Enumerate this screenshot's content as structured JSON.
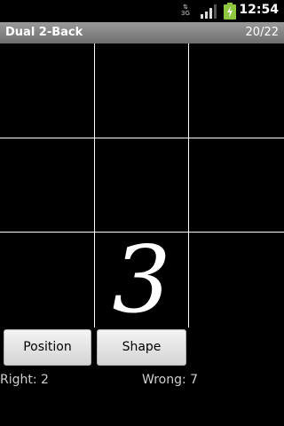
{
  "status_bar": {
    "network_type": "3G",
    "time": "12:54",
    "icons": [
      "signal-icon",
      "battery-charging-icon"
    ]
  },
  "title_bar": {
    "app_title": "Dual 2-Back",
    "progress": "20/22"
  },
  "grid": {
    "rows": 3,
    "cols": 3,
    "active_cell": {
      "row": 3,
      "col": 2
    },
    "stimulus_number": "3"
  },
  "buttons": {
    "position_label": "Position",
    "shape_label": "Shape"
  },
  "score": {
    "right": "Right: 2",
    "wrong": "Wrong: 7"
  },
  "colors": {
    "background": "#000000",
    "title_bar": "#8a8a8a",
    "grid_lines": "#ffffff",
    "battery_green": "#8dc63f"
  }
}
